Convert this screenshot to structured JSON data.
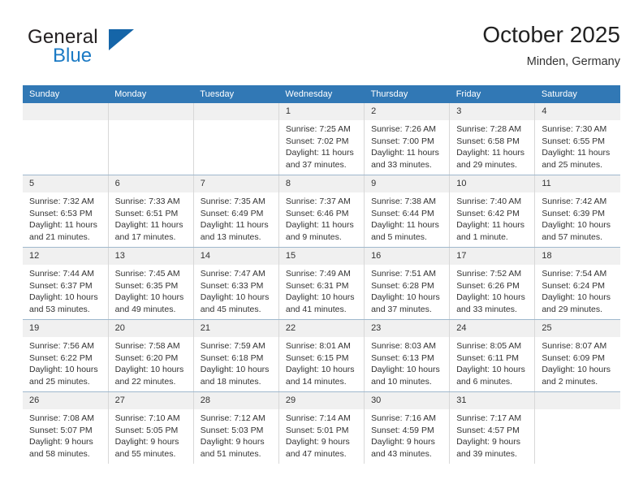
{
  "brand": {
    "name_part1": "General",
    "name_part2": "Blue",
    "triangle_color": "#1565a8",
    "blue_color": "#1b7ac4"
  },
  "header": {
    "title": "October 2025",
    "subtitle": "Minden, Germany"
  },
  "theme": {
    "header_row_bg": "#3178b5",
    "daynum_bg": "#f0f0f0",
    "row_divider": "#9fb8cd",
    "cell_divider": "#d8d8d8"
  },
  "weekday_headers": [
    "Sunday",
    "Monday",
    "Tuesday",
    "Wednesday",
    "Thursday",
    "Friday",
    "Saturday"
  ],
  "weeks": [
    [
      {
        "day": "",
        "sunrise": "",
        "sunset": "",
        "daylight1": "",
        "daylight2": ""
      },
      {
        "day": "",
        "sunrise": "",
        "sunset": "",
        "daylight1": "",
        "daylight2": ""
      },
      {
        "day": "",
        "sunrise": "",
        "sunset": "",
        "daylight1": "",
        "daylight2": ""
      },
      {
        "day": "1",
        "sunrise": "Sunrise: 7:25 AM",
        "sunset": "Sunset: 7:02 PM",
        "daylight1": "Daylight: 11 hours",
        "daylight2": "and 37 minutes."
      },
      {
        "day": "2",
        "sunrise": "Sunrise: 7:26 AM",
        "sunset": "Sunset: 7:00 PM",
        "daylight1": "Daylight: 11 hours",
        "daylight2": "and 33 minutes."
      },
      {
        "day": "3",
        "sunrise": "Sunrise: 7:28 AM",
        "sunset": "Sunset: 6:58 PM",
        "daylight1": "Daylight: 11 hours",
        "daylight2": "and 29 minutes."
      },
      {
        "day": "4",
        "sunrise": "Sunrise: 7:30 AM",
        "sunset": "Sunset: 6:55 PM",
        "daylight1": "Daylight: 11 hours",
        "daylight2": "and 25 minutes."
      }
    ],
    [
      {
        "day": "5",
        "sunrise": "Sunrise: 7:32 AM",
        "sunset": "Sunset: 6:53 PM",
        "daylight1": "Daylight: 11 hours",
        "daylight2": "and 21 minutes."
      },
      {
        "day": "6",
        "sunrise": "Sunrise: 7:33 AM",
        "sunset": "Sunset: 6:51 PM",
        "daylight1": "Daylight: 11 hours",
        "daylight2": "and 17 minutes."
      },
      {
        "day": "7",
        "sunrise": "Sunrise: 7:35 AM",
        "sunset": "Sunset: 6:49 PM",
        "daylight1": "Daylight: 11 hours",
        "daylight2": "and 13 minutes."
      },
      {
        "day": "8",
        "sunrise": "Sunrise: 7:37 AM",
        "sunset": "Sunset: 6:46 PM",
        "daylight1": "Daylight: 11 hours",
        "daylight2": "and 9 minutes."
      },
      {
        "day": "9",
        "sunrise": "Sunrise: 7:38 AM",
        "sunset": "Sunset: 6:44 PM",
        "daylight1": "Daylight: 11 hours",
        "daylight2": "and 5 minutes."
      },
      {
        "day": "10",
        "sunrise": "Sunrise: 7:40 AM",
        "sunset": "Sunset: 6:42 PM",
        "daylight1": "Daylight: 11 hours",
        "daylight2": "and 1 minute."
      },
      {
        "day": "11",
        "sunrise": "Sunrise: 7:42 AM",
        "sunset": "Sunset: 6:39 PM",
        "daylight1": "Daylight: 10 hours",
        "daylight2": "and 57 minutes."
      }
    ],
    [
      {
        "day": "12",
        "sunrise": "Sunrise: 7:44 AM",
        "sunset": "Sunset: 6:37 PM",
        "daylight1": "Daylight: 10 hours",
        "daylight2": "and 53 minutes."
      },
      {
        "day": "13",
        "sunrise": "Sunrise: 7:45 AM",
        "sunset": "Sunset: 6:35 PM",
        "daylight1": "Daylight: 10 hours",
        "daylight2": "and 49 minutes."
      },
      {
        "day": "14",
        "sunrise": "Sunrise: 7:47 AM",
        "sunset": "Sunset: 6:33 PM",
        "daylight1": "Daylight: 10 hours",
        "daylight2": "and 45 minutes."
      },
      {
        "day": "15",
        "sunrise": "Sunrise: 7:49 AM",
        "sunset": "Sunset: 6:31 PM",
        "daylight1": "Daylight: 10 hours",
        "daylight2": "and 41 minutes."
      },
      {
        "day": "16",
        "sunrise": "Sunrise: 7:51 AM",
        "sunset": "Sunset: 6:28 PM",
        "daylight1": "Daylight: 10 hours",
        "daylight2": "and 37 minutes."
      },
      {
        "day": "17",
        "sunrise": "Sunrise: 7:52 AM",
        "sunset": "Sunset: 6:26 PM",
        "daylight1": "Daylight: 10 hours",
        "daylight2": "and 33 minutes."
      },
      {
        "day": "18",
        "sunrise": "Sunrise: 7:54 AM",
        "sunset": "Sunset: 6:24 PM",
        "daylight1": "Daylight: 10 hours",
        "daylight2": "and 29 minutes."
      }
    ],
    [
      {
        "day": "19",
        "sunrise": "Sunrise: 7:56 AM",
        "sunset": "Sunset: 6:22 PM",
        "daylight1": "Daylight: 10 hours",
        "daylight2": "and 25 minutes."
      },
      {
        "day": "20",
        "sunrise": "Sunrise: 7:58 AM",
        "sunset": "Sunset: 6:20 PM",
        "daylight1": "Daylight: 10 hours",
        "daylight2": "and 22 minutes."
      },
      {
        "day": "21",
        "sunrise": "Sunrise: 7:59 AM",
        "sunset": "Sunset: 6:18 PM",
        "daylight1": "Daylight: 10 hours",
        "daylight2": "and 18 minutes."
      },
      {
        "day": "22",
        "sunrise": "Sunrise: 8:01 AM",
        "sunset": "Sunset: 6:15 PM",
        "daylight1": "Daylight: 10 hours",
        "daylight2": "and 14 minutes."
      },
      {
        "day": "23",
        "sunrise": "Sunrise: 8:03 AM",
        "sunset": "Sunset: 6:13 PM",
        "daylight1": "Daylight: 10 hours",
        "daylight2": "and 10 minutes."
      },
      {
        "day": "24",
        "sunrise": "Sunrise: 8:05 AM",
        "sunset": "Sunset: 6:11 PM",
        "daylight1": "Daylight: 10 hours",
        "daylight2": "and 6 minutes."
      },
      {
        "day": "25",
        "sunrise": "Sunrise: 8:07 AM",
        "sunset": "Sunset: 6:09 PM",
        "daylight1": "Daylight: 10 hours",
        "daylight2": "and 2 minutes."
      }
    ],
    [
      {
        "day": "26",
        "sunrise": "Sunrise: 7:08 AM",
        "sunset": "Sunset: 5:07 PM",
        "daylight1": "Daylight: 9 hours",
        "daylight2": "and 58 minutes."
      },
      {
        "day": "27",
        "sunrise": "Sunrise: 7:10 AM",
        "sunset": "Sunset: 5:05 PM",
        "daylight1": "Daylight: 9 hours",
        "daylight2": "and 55 minutes."
      },
      {
        "day": "28",
        "sunrise": "Sunrise: 7:12 AM",
        "sunset": "Sunset: 5:03 PM",
        "daylight1": "Daylight: 9 hours",
        "daylight2": "and 51 minutes."
      },
      {
        "day": "29",
        "sunrise": "Sunrise: 7:14 AM",
        "sunset": "Sunset: 5:01 PM",
        "daylight1": "Daylight: 9 hours",
        "daylight2": "and 47 minutes."
      },
      {
        "day": "30",
        "sunrise": "Sunrise: 7:16 AM",
        "sunset": "Sunset: 4:59 PM",
        "daylight1": "Daylight: 9 hours",
        "daylight2": "and 43 minutes."
      },
      {
        "day": "31",
        "sunrise": "Sunrise: 7:17 AM",
        "sunset": "Sunset: 4:57 PM",
        "daylight1": "Daylight: 9 hours",
        "daylight2": "and 39 minutes."
      },
      {
        "day": "",
        "sunrise": "",
        "sunset": "",
        "daylight1": "",
        "daylight2": ""
      }
    ]
  ]
}
